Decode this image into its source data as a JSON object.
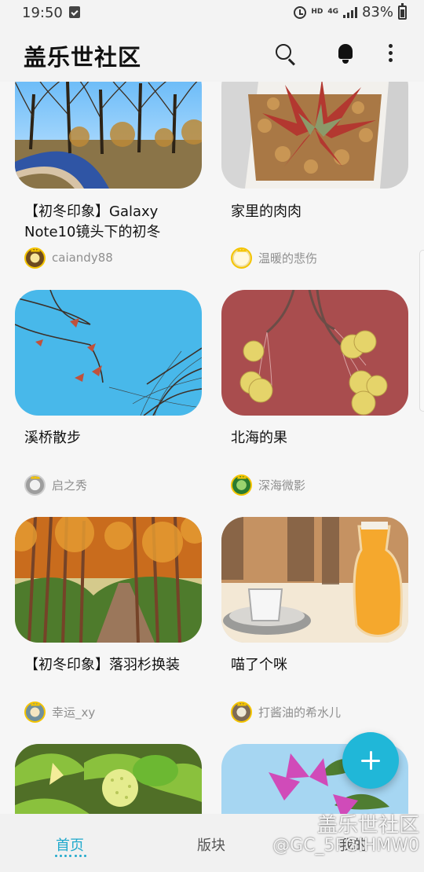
{
  "status_bar": {
    "time": "19:50",
    "network_hd": "HD",
    "network_type": "4G",
    "battery": "83%"
  },
  "app_bar": {
    "title": "盖乐世社区",
    "icons": [
      "search-icon",
      "bell-icon",
      "more-vertical-icon"
    ]
  },
  "feed": {
    "posts": [
      {
        "title": "【初冬印象】Galaxy Note10镜头下的初冬",
        "author": "caiandy88",
        "image": "park-trees"
      },
      {
        "title": "家里的肉肉",
        "author": "温暖的悲伤",
        "image": "succulent"
      },
      {
        "title": "溪桥散步",
        "author": "启之秀",
        "image": "blue-sky-branches"
      },
      {
        "title": "北海的果",
        "author": "深海微影",
        "image": "yellow-berries"
      },
      {
        "title": "【初冬印象】落羽杉换装",
        "author": "幸运_xy",
        "image": "autumn-path"
      },
      {
        "title": "喵了个咪",
        "author": "打酱油的希水儿",
        "image": "glass-drinks"
      },
      {
        "title": "",
        "author": "",
        "image": "strawberry"
      },
      {
        "title": "",
        "author": "",
        "image": "pink-flower"
      }
    ]
  },
  "bottom_nav": {
    "home": "首页",
    "boards": "版块",
    "partial": "我的"
  },
  "watermark": {
    "title": "盖乐世社区",
    "user": "@GC_5FGIHMW0"
  },
  "colors": {
    "accent": "#20a9cc",
    "fab": "#20b7d8",
    "avatar_border": "#f4c400"
  }
}
